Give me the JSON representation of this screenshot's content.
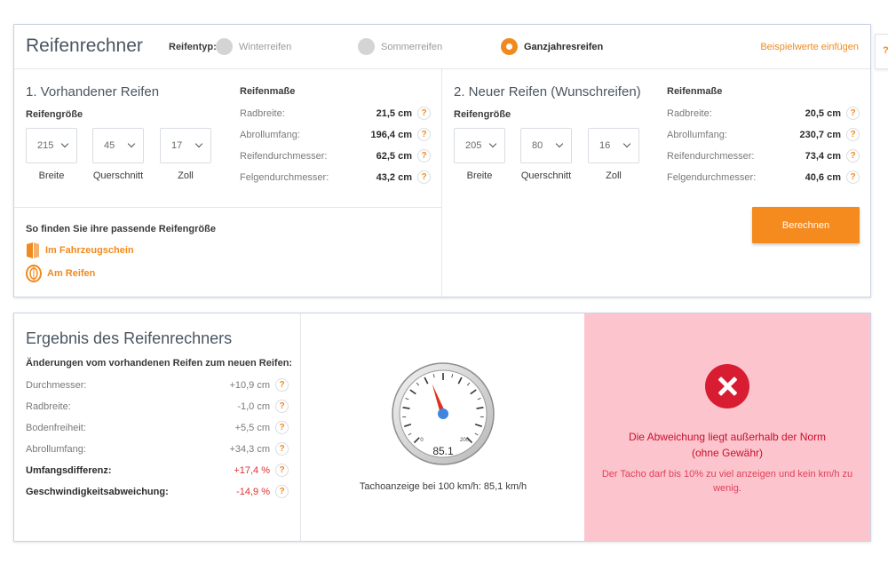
{
  "header": {
    "title": "Reifenrechner",
    "type_label": "Reifentyp:",
    "tire_types": [
      {
        "label": "Winterreifen",
        "selected": false
      },
      {
        "label": "Sommerreifen",
        "selected": false
      },
      {
        "label": "Ganzjahresreifen",
        "selected": true
      }
    ],
    "example_link": "Beispielwerte einfügen"
  },
  "current_tire": {
    "title": "1. Vorhandener Reifen",
    "size_label": "Reifengröße",
    "selects": [
      {
        "value": "215",
        "caption": "Breite"
      },
      {
        "value": "45",
        "caption": "Querschnitt"
      },
      {
        "value": "17",
        "caption": "Zoll"
      }
    ],
    "measures_title": "Reifenmaße",
    "measures": [
      {
        "label": "Radbreite:",
        "value": "21,5 cm"
      },
      {
        "label": "Abrollumfang:",
        "value": "196,4 cm"
      },
      {
        "label": "Reifendurchmesser:",
        "value": "62,5 cm"
      },
      {
        "label": "Felgendurchmesser:",
        "value": "43,2 cm"
      }
    ]
  },
  "new_tire": {
    "title": "2. Neuer Reifen (Wunschreifen)",
    "size_label": "Reifengröße",
    "selects": [
      {
        "value": "205",
        "caption": "Breite"
      },
      {
        "value": "80",
        "caption": "Querschnitt"
      },
      {
        "value": "16",
        "caption": "Zoll"
      }
    ],
    "measures_title": "Reifenmaße",
    "measures": [
      {
        "label": "Radbreite:",
        "value": "20,5 cm"
      },
      {
        "label": "Abrollumfang:",
        "value": "230,7 cm"
      },
      {
        "label": "Reifendurchmesser:",
        "value": "73,4 cm"
      },
      {
        "label": "Felgendurchmesser:",
        "value": "40,6 cm"
      }
    ]
  },
  "find_size": {
    "title": "So finden Sie ihre passende Reifengröße",
    "links": [
      "Im Fahrzeugschein",
      "Am Reifen"
    ]
  },
  "calc_button": "Berechnen",
  "help_glyph": "?",
  "result": {
    "title": "Ergebnis des Reifenrechners",
    "subtitle": "Änderungen vom vorhandenen Reifen zum neuen Reifen:",
    "rows": [
      {
        "label": "Durchmesser:",
        "value": "+10,9 cm",
        "bold": false
      },
      {
        "label": "Radbreite:",
        "value": "-1,0 cm",
        "bold": false
      },
      {
        "label": "Bodenfreiheit:",
        "value": "+5,5 cm",
        "bold": false
      },
      {
        "label": "Abrollumfang:",
        "value": "+34,3 cm",
        "bold": false
      },
      {
        "label": "Umfangsdifferenz:",
        "value": "+17,4 %",
        "bold": true
      },
      {
        "label": "Geschwindigkeitsabweichung:",
        "value": "-14,9 %",
        "bold": true
      }
    ],
    "tacho": {
      "reading": "85.1",
      "scale_min": "0",
      "scale_max": "200",
      "needle_value": 85.1,
      "caption": "Tachoanzeige bei 100 km/h: 85,1 km/h"
    },
    "verdict": {
      "main_line1": "Die Abweichung liegt außerhalb der Norm",
      "main_line2": "(ohne Gewähr)",
      "sub": "Der Tacho darf bis 10% zu viel anzeigen und kein km/h zu wenig.",
      "icon": "error-cross-icon"
    }
  },
  "colors": {
    "accent": "#f08a1e",
    "error": "#d81c32",
    "error_bg": "#fcc5cd"
  }
}
